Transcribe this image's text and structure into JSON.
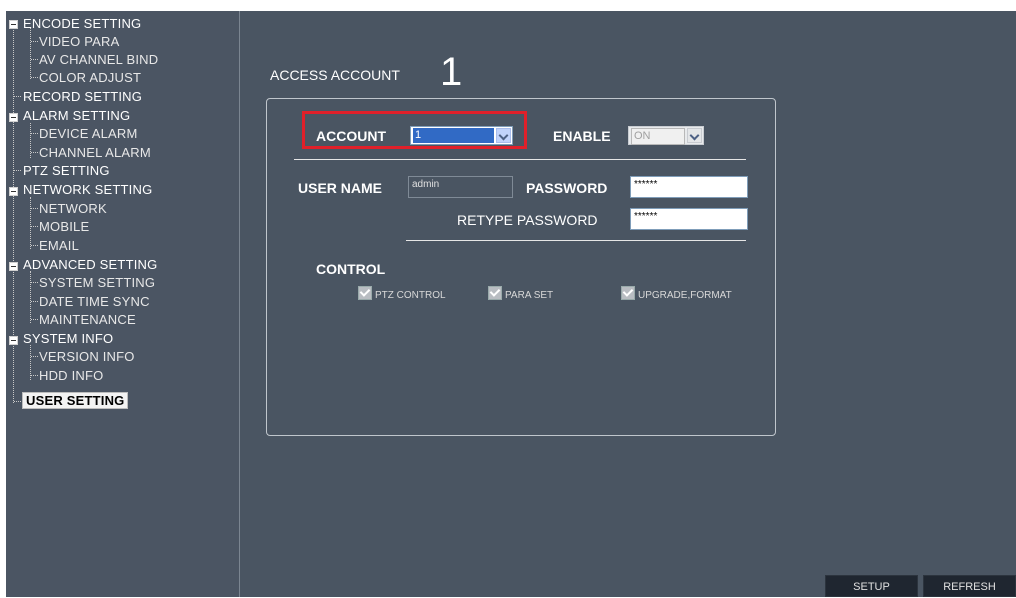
{
  "tree": {
    "items": [
      {
        "label": "ENCODE SETTING",
        "level": 0,
        "expander": "minus"
      },
      {
        "label": "VIDEO PARA",
        "level": 1
      },
      {
        "label": "AV CHANNEL BIND",
        "level": 1
      },
      {
        "label": "COLOR ADJUST",
        "level": 1
      },
      {
        "label": "RECORD SETTING",
        "level": 0
      },
      {
        "label": "ALARM SETTING",
        "level": 0,
        "expander": "minus"
      },
      {
        "label": "DEVICE ALARM",
        "level": 1
      },
      {
        "label": "CHANNEL ALARM",
        "level": 1
      },
      {
        "label": "PTZ SETTING",
        "level": 0
      },
      {
        "label": "NETWORK SETTING",
        "level": 0,
        "expander": "minus"
      },
      {
        "label": "NETWORK",
        "level": 1
      },
      {
        "label": "MOBILE",
        "level": 1
      },
      {
        "label": "EMAIL",
        "level": 1
      },
      {
        "label": "ADVANCED SETTING",
        "level": 0,
        "expander": "minus"
      },
      {
        "label": "SYSTEM SETTING",
        "level": 1
      },
      {
        "label": "DATE TIME SYNC",
        "level": 1
      },
      {
        "label": "MAINTENANCE",
        "level": 1
      },
      {
        "label": "SYSTEM INFO",
        "level": 0,
        "expander": "minus"
      },
      {
        "label": "VERSION INFO",
        "level": 1
      },
      {
        "label": "HDD INFO",
        "level": 1
      },
      {
        "label": "USER SETTING",
        "level": 0,
        "selected": true
      }
    ]
  },
  "section_title": "ACCESS ACCOUNT",
  "annotation": "1",
  "account": {
    "label": "ACCOUNT",
    "value": "1"
  },
  "enable": {
    "label": "ENABLE",
    "value": "ON"
  },
  "user_name": {
    "label": "USER NAME",
    "value": "admin"
  },
  "password": {
    "label": "PASSWORD",
    "value": "******"
  },
  "retype_password": {
    "label": "RETYPE PASSWORD",
    "value": "******"
  },
  "control": {
    "label": "CONTROL",
    "options": [
      {
        "label": "PTZ CONTROL",
        "checked": true
      },
      {
        "label": "PARA SET",
        "checked": true
      },
      {
        "label": "UPGRADE,FORMAT",
        "checked": true
      }
    ]
  },
  "buttons": {
    "setup": "SETUP",
    "refresh": "REFRESH"
  },
  "colors": {
    "background": "#4a5562",
    "highlight": "#e0202a",
    "selected_bg": "#f3f3f3"
  }
}
